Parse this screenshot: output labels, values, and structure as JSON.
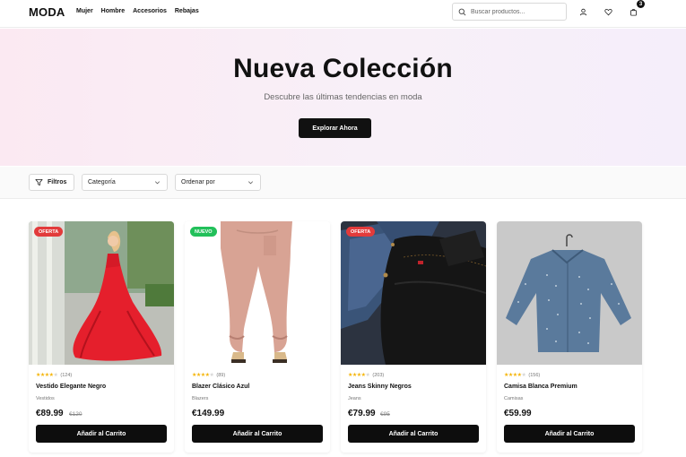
{
  "header": {
    "logo": "MODA",
    "nav": [
      "Mujer",
      "Hombre",
      "Accesorios",
      "Rebajas"
    ],
    "search_placeholder": "Buscar productos...",
    "icons": [
      "user-icon",
      "heart-icon",
      "shopping-bag-icon"
    ],
    "cart_count": "3"
  },
  "hero": {
    "title": "Nueva Colección",
    "subtitle": "Descubre las últimas tendencias en moda",
    "cta": "Explorar Ahora"
  },
  "filters": {
    "filter_label": "Filtros",
    "category_label": "Categoría",
    "sort_label": "Ordenar por"
  },
  "products": [
    {
      "badge": "OFERTA",
      "badge_color": "#e23b3b",
      "rating": 4,
      "reviews": "(124)",
      "name": "Vestido Elegante Negro",
      "category": "Vestidos",
      "price": "€89.99",
      "old_price": "€120",
      "cta": "Añadir al Carrito"
    },
    {
      "badge": "NUEVO",
      "badge_color": "#22c05a",
      "rating": 4,
      "reviews": "(89)",
      "name": "Blazer Clásico Azul",
      "category": "Blazers",
      "price": "€149.99",
      "old_price": "",
      "cta": "Añadir al Carrito"
    },
    {
      "badge": "OFERTA",
      "badge_color": "#e23b3b",
      "rating": 4,
      "reviews": "(203)",
      "name": "Jeans Skinny Negros",
      "category": "Jeans",
      "price": "€79.99",
      "old_price": "€95",
      "cta": "Añadir al Carrito"
    },
    {
      "badge": "",
      "badge_color": "",
      "rating": 4,
      "reviews": "(156)",
      "name": "Camisa Blanca Premium",
      "category": "Camisas",
      "price": "€59.99",
      "old_price": "",
      "cta": "Añadir al Carrito"
    }
  ]
}
